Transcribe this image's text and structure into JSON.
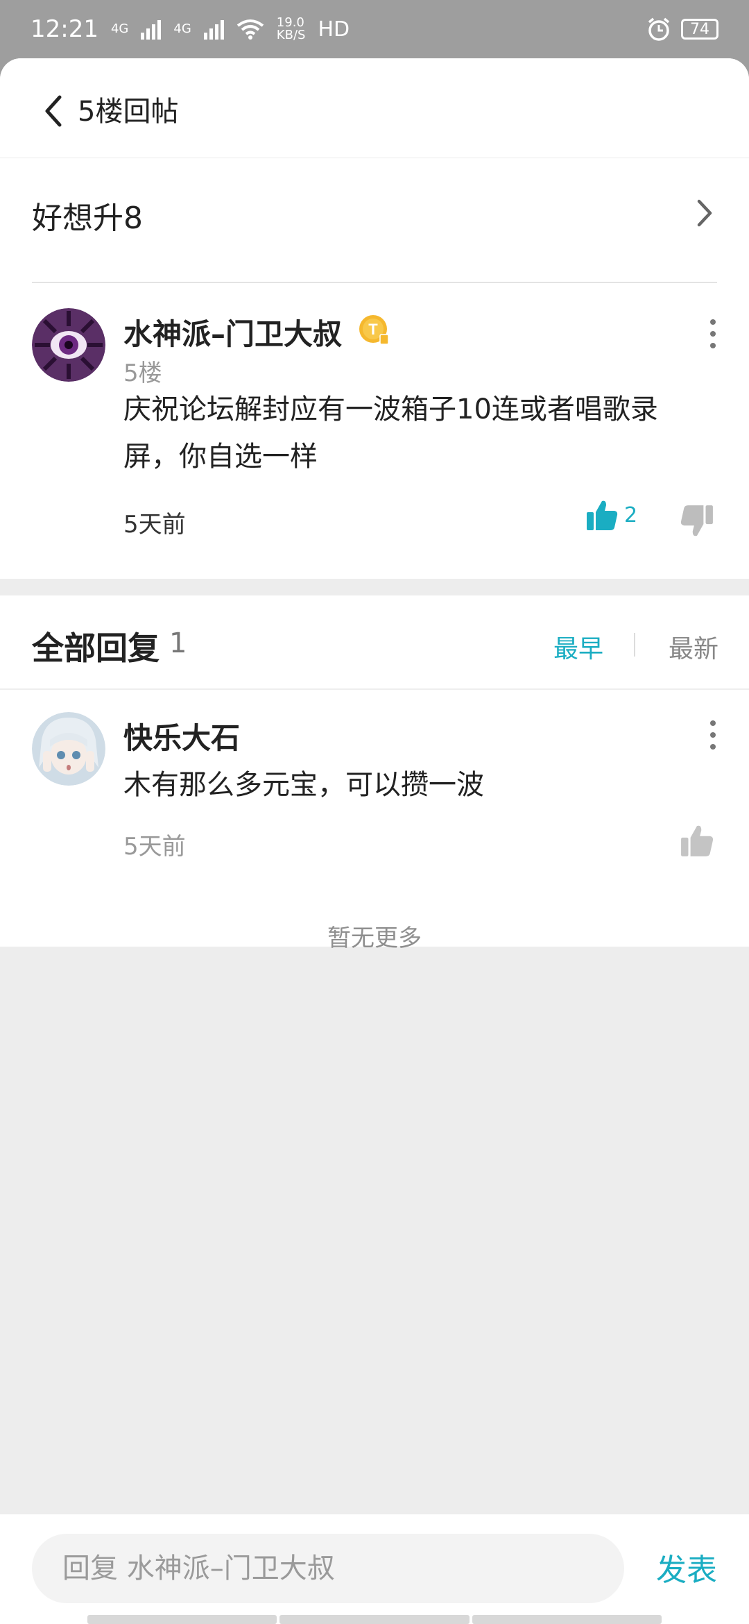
{
  "status_bar": {
    "time": "12:21",
    "network1": "4G",
    "network2": "4G",
    "speed_top": "19.0",
    "speed_bottom": "KB/S",
    "hd_label": "HD",
    "battery": "74"
  },
  "header": {
    "title": "5楼回帖"
  },
  "thread": {
    "title": "好想升8"
  },
  "post": {
    "author": "水神派–门卫大叔",
    "badge_icon": "T-badge-icon",
    "floor": "5楼",
    "content": "庆祝论坛解封应有一波箱子10连或者唱歌录屏，你自选一样",
    "time": "5天前",
    "like_count": "2"
  },
  "replies": {
    "title": "全部回复",
    "count": "1",
    "sort_earliest": "最早",
    "sort_newest": "最新",
    "items": [
      {
        "author": "快乐大石",
        "content": "木有那么多元宝，可以攒一波",
        "time": "5天前"
      }
    ],
    "no_more": "暂无更多"
  },
  "composer": {
    "placeholder": "回复 水神派–门卫大叔",
    "send_label": "发表"
  },
  "colors": {
    "accent": "#1aadc2",
    "badge": "#f5b82e"
  }
}
